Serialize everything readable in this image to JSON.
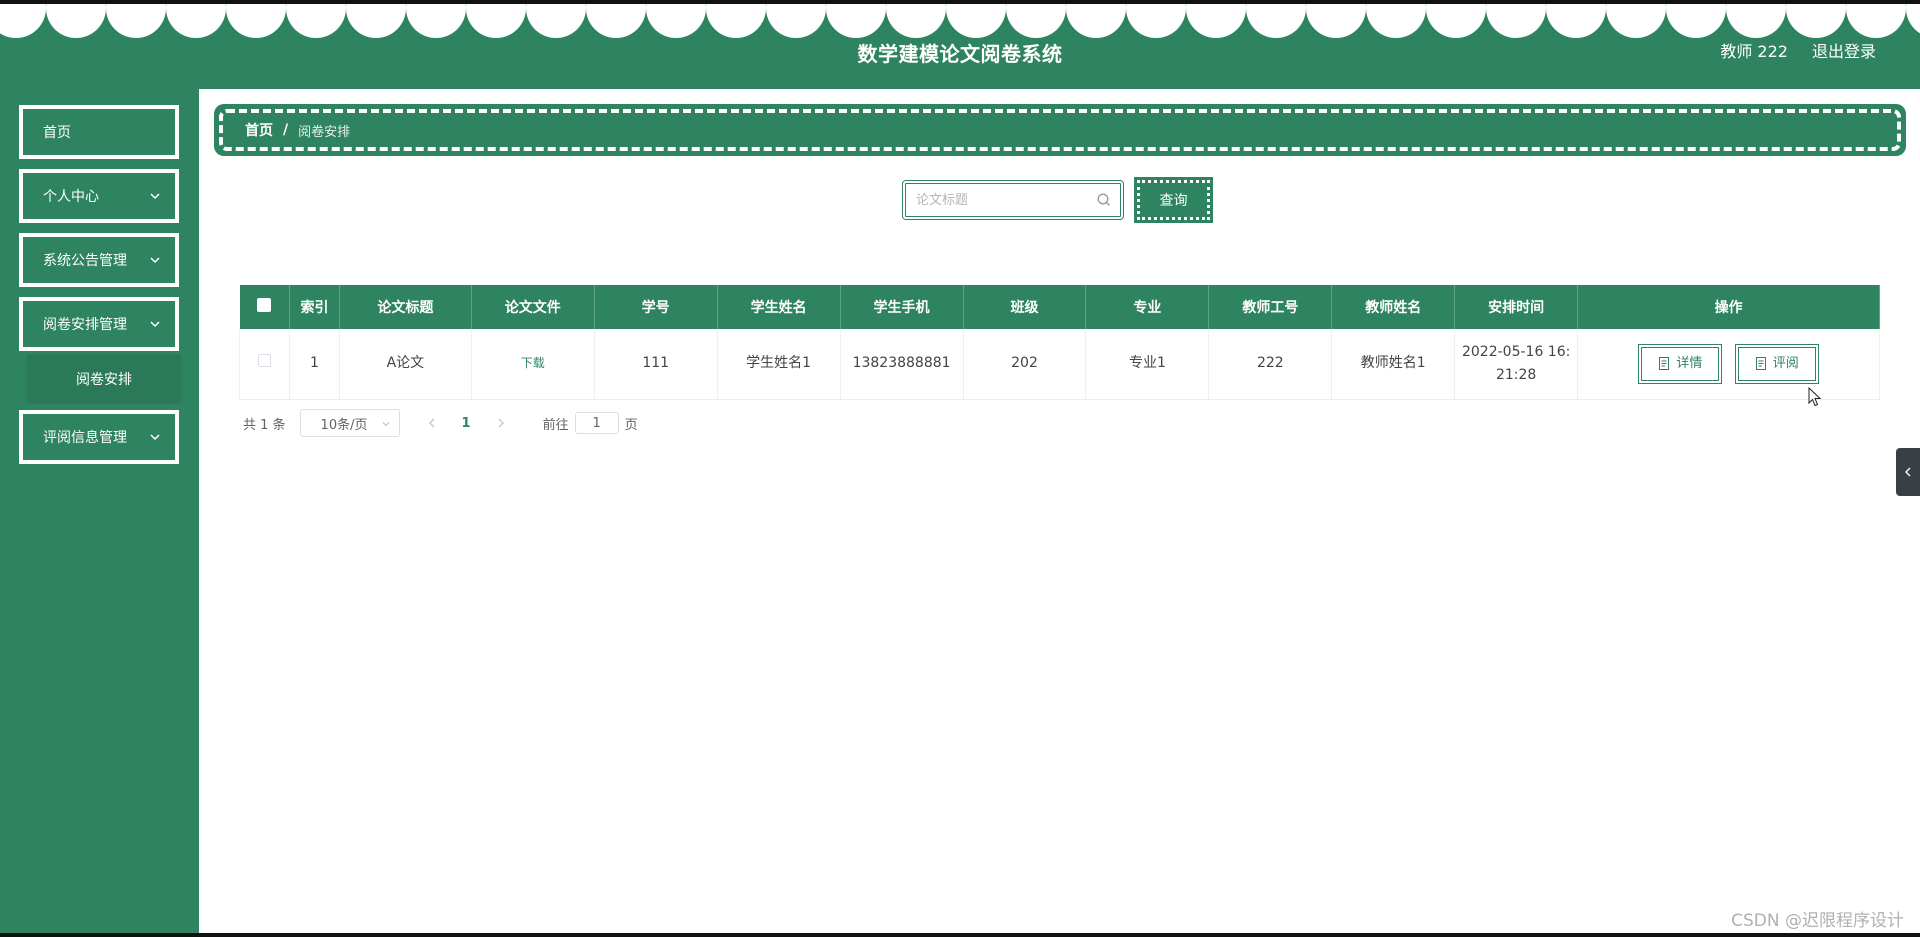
{
  "header": {
    "title": "数学建模论文阅卷系统",
    "user_label": "教师 222",
    "logout_label": "退出登录",
    "bg_color": "#2e8361"
  },
  "sidebar": {
    "items": [
      {
        "label": "首页",
        "has_children": false
      },
      {
        "label": "个人中心",
        "has_children": true,
        "icon": "chevron-down-icon"
      },
      {
        "label": "系统公告管理",
        "has_children": true,
        "icon": "chevron-down-icon"
      },
      {
        "label": "阅卷安排管理",
        "has_children": true,
        "icon": "chevron-down-icon",
        "expanded": true,
        "children": [
          {
            "label": "阅卷安排"
          }
        ]
      },
      {
        "label": "评阅信息管理",
        "has_children": true,
        "icon": "chevron-down-icon"
      }
    ]
  },
  "breadcrumb": {
    "home": "首页",
    "separator": "/",
    "current": "阅卷安排"
  },
  "search": {
    "placeholder": "论文标题",
    "value": "",
    "button_label": "查询",
    "icon": "search-icon"
  },
  "table": {
    "columns": [
      "索引",
      "论文标题",
      "论文文件",
      "学号",
      "学生姓名",
      "学生手机",
      "班级",
      "专业",
      "教师工号",
      "教师姓名",
      "安排时间",
      "操作"
    ],
    "rows": [
      {
        "index": "1",
        "title": "A论文",
        "file": "下载",
        "student_id": "111",
        "student_name": "学生姓名1",
        "phone": "13823888881",
        "class": "202",
        "major": "专业1",
        "teacher_id": "222",
        "teacher_name": "教师姓名1",
        "time_line1": "2022-05-16 16:",
        "time_line2": "21:28",
        "actions": [
          {
            "label": "详情",
            "icon": "document-icon"
          },
          {
            "label": "评阅",
            "icon": "document-icon"
          }
        ]
      }
    ]
  },
  "pagination": {
    "total_label": "共 1 条",
    "page_size": "10条/页",
    "current_page": "1",
    "goto_prefix": "前往",
    "goto_value": "1",
    "goto_suffix": "页"
  },
  "watermark": "CSDN @迟限程序设计",
  "colors": {
    "primary": "#2e8361",
    "white": "#ffffff",
    "drawer": "#3a3f45"
  }
}
